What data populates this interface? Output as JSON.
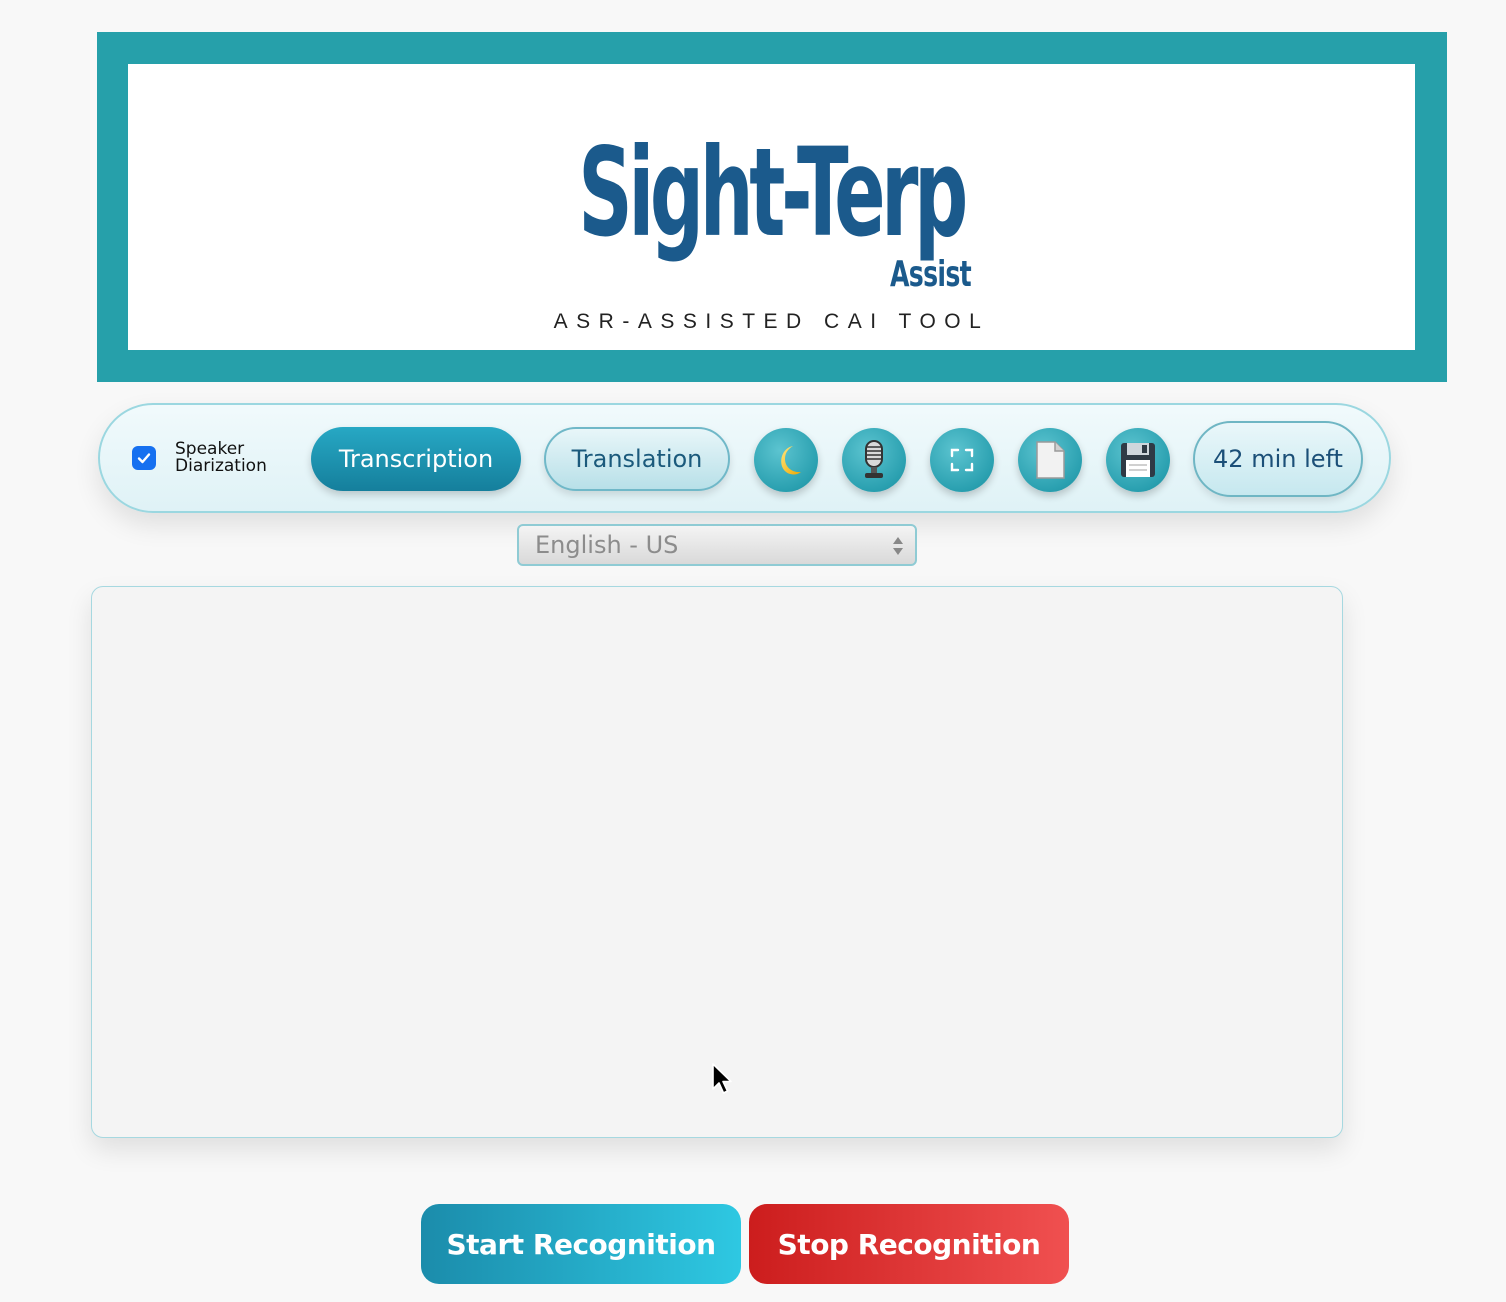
{
  "banner": {
    "logo_title": "Sight-Terp",
    "logo_subtitle": "Assist",
    "tagline": "ASR-ASSISTED CAI TOOL"
  },
  "toolbar": {
    "speaker_diarization": {
      "label": "Speaker Diarization",
      "checked": true
    },
    "transcription_label": "Transcription",
    "translation_label": "Translation",
    "icons": [
      "moon-icon",
      "microphone-icon",
      "fullscreen-icon",
      "new-document-icon",
      "save-floppy-icon"
    ],
    "time_left": "42 min left"
  },
  "language_select": {
    "value": "English - US"
  },
  "transcript": {
    "text": ""
  },
  "actions": {
    "start_label": "Start Recognition",
    "stop_label": "Stop Recognition"
  },
  "colors": {
    "banner_teal": "#26a0aa",
    "logo_blue": "#1b5a8c",
    "start_button": "#1b8cab",
    "stop_button": "#cc1d1d",
    "checkbox_blue": "#1670f0"
  }
}
